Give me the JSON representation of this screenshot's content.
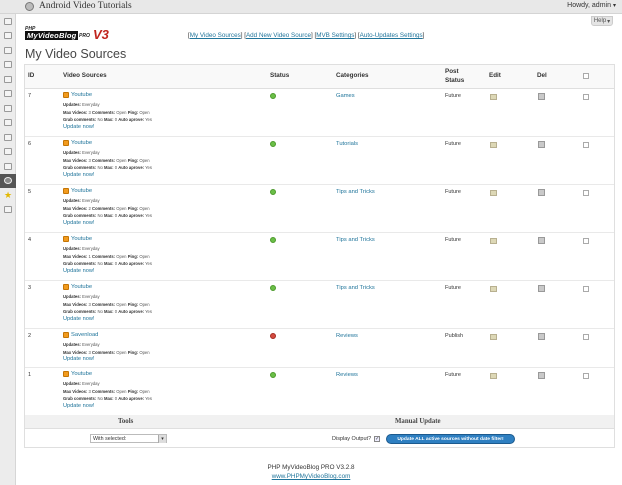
{
  "admin_bar": {
    "site_title": "Android Video Tutorials",
    "greeting": "Howdy, admin"
  },
  "help_tab": "Help",
  "logo": {
    "pre": "PHP",
    "main": "MyVideoBlog",
    "pro": "PRO",
    "version": "V3"
  },
  "nav": {
    "items": [
      "My Video Sources",
      "Add New Video Source",
      "MVB Settings",
      "Auto-Updates Settings"
    ]
  },
  "page_title": "My Video Sources",
  "table": {
    "headers": {
      "id": "ID",
      "sources": "Video Sources",
      "status": "Status",
      "categories": "Categories",
      "post_status_1": "Post",
      "post_status_2": "Status",
      "edit": "Edit",
      "del": "Del"
    },
    "labels": {
      "updates": "Updates:",
      "max_videos": "Max Videos:",
      "comments": "Comments:",
      "ping": "Ping:",
      "grab_comments": "Grab comments:",
      "max": "Max:",
      "auto_aprove": "Auto aprove:",
      "update_now": "Update now!"
    },
    "rows": [
      {
        "id": "7",
        "source": "Youtube",
        "updates": "Everyday",
        "max_videos": "3",
        "comments": "Open",
        "ping": "Open",
        "grab": "No",
        "max": "0",
        "auto": "Yes",
        "status": "green",
        "category": "Games",
        "post_status": "Future"
      },
      {
        "id": "6",
        "source": "Youtube",
        "updates": "Everyday",
        "max_videos": "3",
        "comments": "Open",
        "ping": "Open",
        "grab": "No",
        "max": "0",
        "auto": "Yes",
        "status": "green",
        "category": "Tutorials",
        "post_status": "Future"
      },
      {
        "id": "5",
        "source": "Youtube",
        "updates": "Everyday",
        "max_videos": "2",
        "comments": "Open",
        "ping": "Open",
        "grab": "No",
        "max": "0",
        "auto": "Yes",
        "status": "green",
        "category": "Tips and Tricks",
        "post_status": "Future"
      },
      {
        "id": "4",
        "source": "Youtube",
        "updates": "Everyday",
        "max_videos": "1",
        "comments": "Open",
        "ping": "Open",
        "grab": "No",
        "max": "0",
        "auto": "Yes",
        "status": "green",
        "category": "Tips and Tricks",
        "post_status": "Future"
      },
      {
        "id": "3",
        "source": "Youtube",
        "updates": "Everyday",
        "max_videos": "3",
        "comments": "Open",
        "ping": "Open",
        "grab": "No",
        "max": "0",
        "auto": "Yes",
        "status": "green",
        "category": "Tips and Tricks",
        "post_status": "Future"
      },
      {
        "id": "2",
        "source": "Savenload",
        "updates": "Everyday",
        "max_videos": "3",
        "comments": "Open",
        "ping": "Open",
        "grab": "",
        "max": "",
        "auto": "",
        "status": "red",
        "category": "Reviews",
        "post_status": "Publish"
      },
      {
        "id": "1",
        "source": "Youtube",
        "updates": "Everyday",
        "max_videos": "3",
        "comments": "Open",
        "ping": "Open",
        "grab": "No",
        "max": "0",
        "auto": "Yes",
        "status": "green",
        "category": "Reviews",
        "post_status": "Future"
      }
    ]
  },
  "footer_bar": {
    "tools_label": "Tools",
    "manual_update_label": "Manual Update",
    "select_value": "With selected:",
    "display_output_label": "Display Output?",
    "update_all_button": "Update ALL active sources without date filter!"
  },
  "credits": {
    "product": "PHP MyVideoBlog PRO V3.2.8",
    "link": "www.PHPMyVideoBlog.com"
  },
  "colors": {
    "link": "#21759b",
    "status_ok": "#6bbf47",
    "status_error": "#d34b3f",
    "button": "#2e7fc1"
  }
}
